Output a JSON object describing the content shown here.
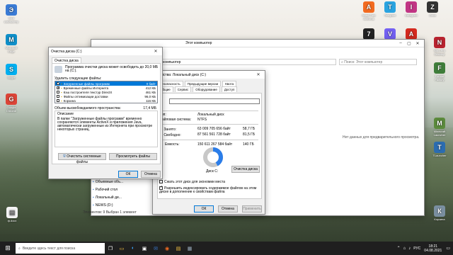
{
  "desktop": {
    "left_icons": [
      {
        "label": "Этот\nкомпьютер",
        "icon": "computer-icon",
        "color": "#3a7bd5"
      },
      {
        "label": "Microsoft\nEdge",
        "icon": "edge-icon",
        "color": "#0f8fc9"
      },
      {
        "label": "Skype",
        "icon": "skype-icon",
        "color": "#00aff0"
      },
      {
        "label": "Google\nChrome",
        "icon": "chrome-icon",
        "color": "#db4437"
      }
    ],
    "top_icons": [
      {
        "label": "Avast Free\nAntivirus",
        "icon": "avast-icon",
        "color": "#f26b21"
      },
      {
        "label": "Telegram",
        "icon": "telegram-icon",
        "color": "#2aa3e0"
      },
      {
        "label": "Instagram",
        "icon": "instagram-icon",
        "color": "#c13584"
      },
      {
        "label": "Zona",
        "icon": "zona-icon",
        "color": "#333333"
      },
      {
        "label": "7-Zip",
        "icon": "7zip-icon",
        "color": "#222222"
      },
      {
        "label": "Viber",
        "icon": "viber-icon",
        "color": "#7360f2"
      },
      {
        "label": "Adobe\nReader",
        "icon": "acrobat-icon",
        "color": "#d42a1f"
      }
    ],
    "right_icons": [
      {
        "label": "Nitro Pro\nDesktop",
        "icon": "nitro-icon",
        "color": "#b8232f"
      },
      {
        "label": "Format\nFactory",
        "icon": "formatfactory-icon",
        "color": "#3f7d3a"
      },
      {
        "label": "Minecraft\nLauncher",
        "icon": "minecraft-icon",
        "color": "#5b8a3c"
      },
      {
        "label": "TLauncher",
        "icon": "tlauncher-icon",
        "color": "#2b6cb0"
      },
      {
        "label": "Корзина",
        "icon": "recycle-bin-icon",
        "color": "#7a8fa0"
      }
    ],
    "bottom_left_icon": {
      "label": "ф.docx",
      "icon": "document-icon",
      "color": "#6a6a6a"
    }
  },
  "explorer": {
    "title": "Этот компьютер",
    "address": "Этот компьютер",
    "search_placeholder": "Поиск: Этот компьютер",
    "preview_text": "Нет данных для предварительного просмотра.",
    "nav": [
      {
        "label": "Объемные объ..."
      },
      {
        "label": "Рабочий стол"
      },
      {
        "label": "Локальный ди..."
      },
      {
        "label": "NEWS (D:)"
      }
    ],
    "status": "Элементов: 9    Выбран 1 элемент"
  },
  "properties": {
    "title": "Свойства: Локальный диск (C:)",
    "tabs_top": [
      "Безопасность",
      "Предыдущие версии",
      "Квота"
    ],
    "tabs_bottom": [
      "Общие",
      "Сервис",
      "Оборудование",
      "Доступ"
    ],
    "type_label": "Тип:",
    "type_value": "Локальный диск",
    "fs_label": "Файловая система:",
    "fs_value": "NTFS",
    "used_label": "Занято:",
    "used_bytes": "63 009 705 656 байт",
    "used_gb": "58,7 ГБ",
    "free_label": "Свободно:",
    "free_bytes": "87 561 561 728 байт",
    "free_gb": "81,5 ГБ",
    "capacity_label": "Емкость:",
    "capacity_bytes": "150 611 267 584 байт",
    "capacity_gb": "140 ГБ",
    "used_fraction": 0.42,
    "disk_label": "Диск C:",
    "cleanup_button": "Очистка диска",
    "compress_label": "Сжать этот диск для экономии места",
    "index_label": "Разрешить индексировать содержимое файлов на этом диске в дополнение к свойствам файла",
    "ok": "ОК",
    "cancel": "Отмена",
    "apply": "Применить",
    "used_color": "#2b7de9",
    "free_color": "#c8c8c8"
  },
  "cleanup": {
    "title": "Очистка диска (C:)",
    "tab": "Очистка диска",
    "intro": "Программа очистки диска может освободить до 20,0 МБ на (C:).",
    "delete_label": "Удалить следующие файлы:",
    "files": [
      {
        "name": "Загруженные файлы программ",
        "size": "0 байт",
        "checked": true,
        "selected": true
      },
      {
        "name": "Временные файлы Интернета",
        "size": "412 КБ",
        "checked": true,
        "selected": false
      },
      {
        "name": "Кэш построителя текстур DirectX",
        "size": "461 КБ",
        "checked": false,
        "selected": false
      },
      {
        "name": "Файлы оптимизации доставки",
        "size": "96,0 КБ",
        "checked": false,
        "selected": false
      },
      {
        "name": "Корзина",
        "size": "116 КБ",
        "checked": false,
        "selected": false
      }
    ],
    "total_label": "Объем высвобождаемого пространства:",
    "total_value": "17,4 МБ",
    "desc_label": "Описание",
    "description": "В папке \"Загруженные файлы программ\" временно сохраняются элементы ActiveX и приложения Java, автоматически загруженные из Интернета при просмотре некоторых страниц.",
    "system_button": "Очистить системные файлы",
    "view_button": "Просмотреть файлы",
    "ok": "ОК",
    "cancel": "Отмена"
  },
  "taskbar": {
    "search_placeholder": "Введите здесь текст для поиска",
    "language": "РУС",
    "time": "18:21",
    "date": "04.08.2021"
  }
}
